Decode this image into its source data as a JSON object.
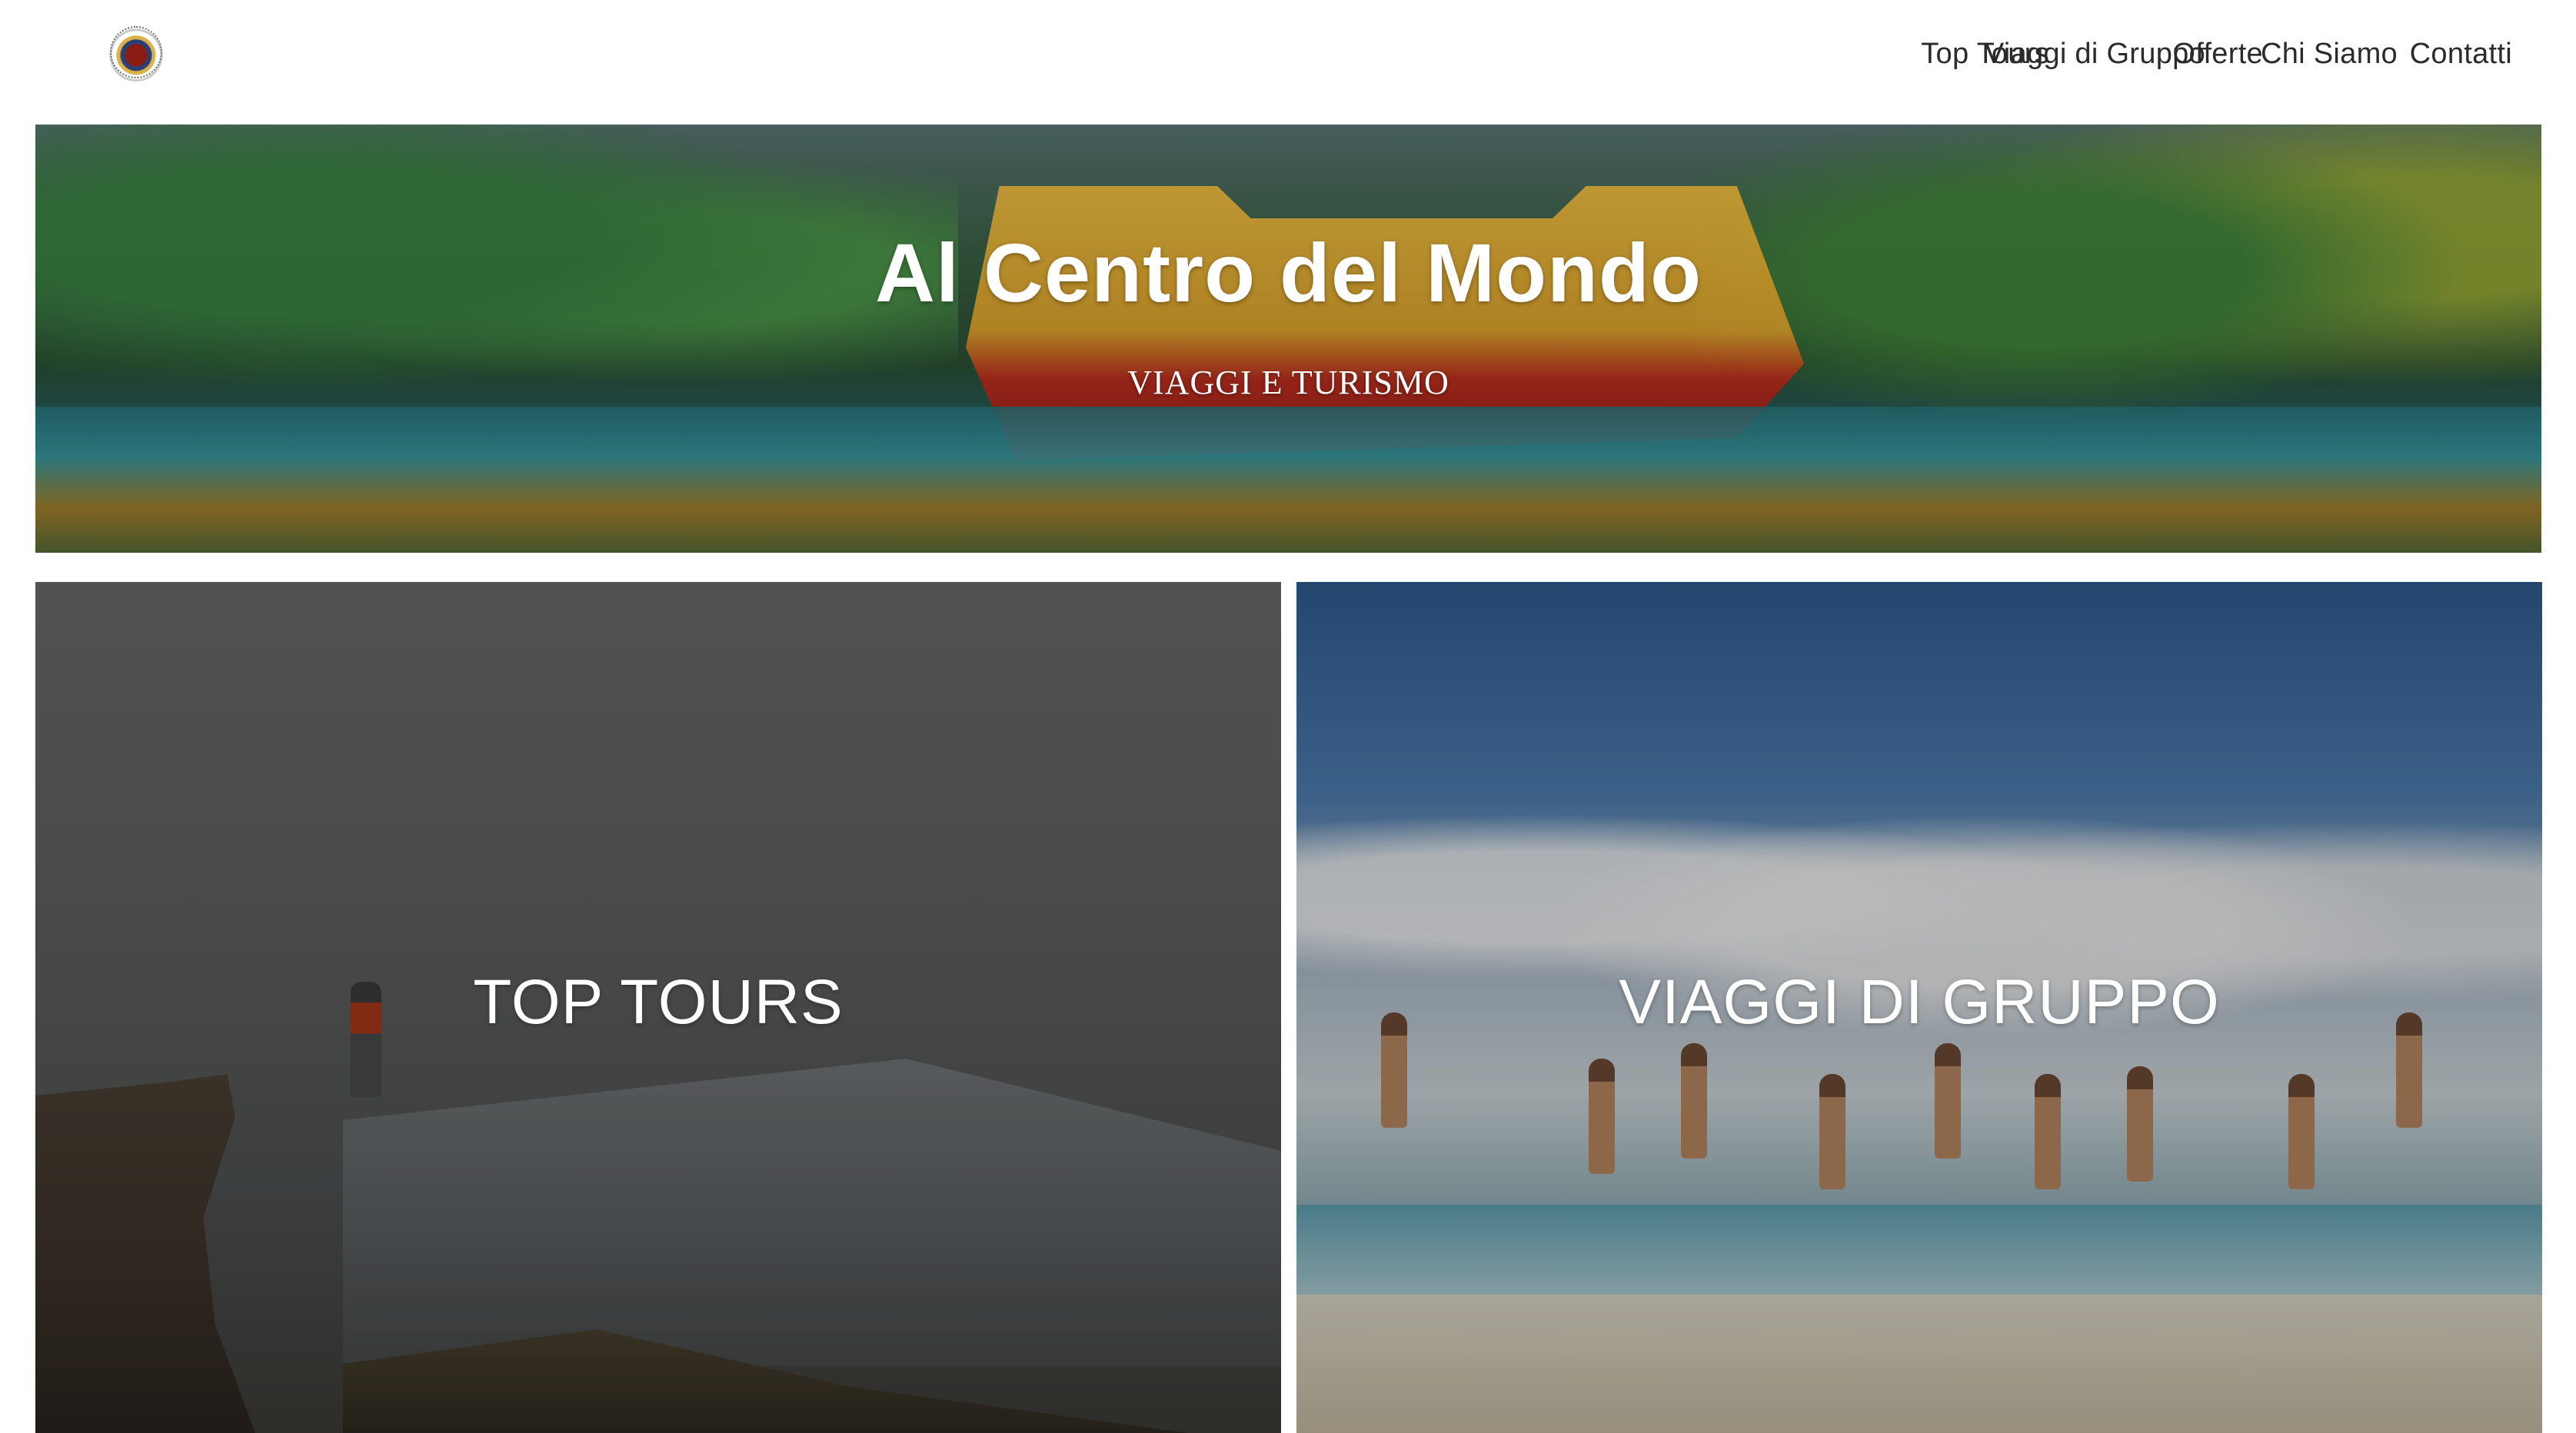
{
  "header": {
    "logo_icon": "travel-agency-logo-icon",
    "nav": [
      {
        "label": "Top Tours"
      },
      {
        "label": "Viaggi di Gruppo"
      },
      {
        "label": "Offerte"
      },
      {
        "label": "Chi Siamo"
      },
      {
        "label": "Contatti"
      }
    ]
  },
  "hero": {
    "title": "Al Centro del Mondo",
    "subtitle": "VIAGGI E TURISMO"
  },
  "cards": [
    {
      "label": "TOP TOURS"
    },
    {
      "label": "VIAGGI DI GRUPPO"
    }
  ],
  "colors": {
    "nav_text": "#2b2b2b",
    "overlay_text": "#ffffff",
    "background": "#ffffff"
  }
}
